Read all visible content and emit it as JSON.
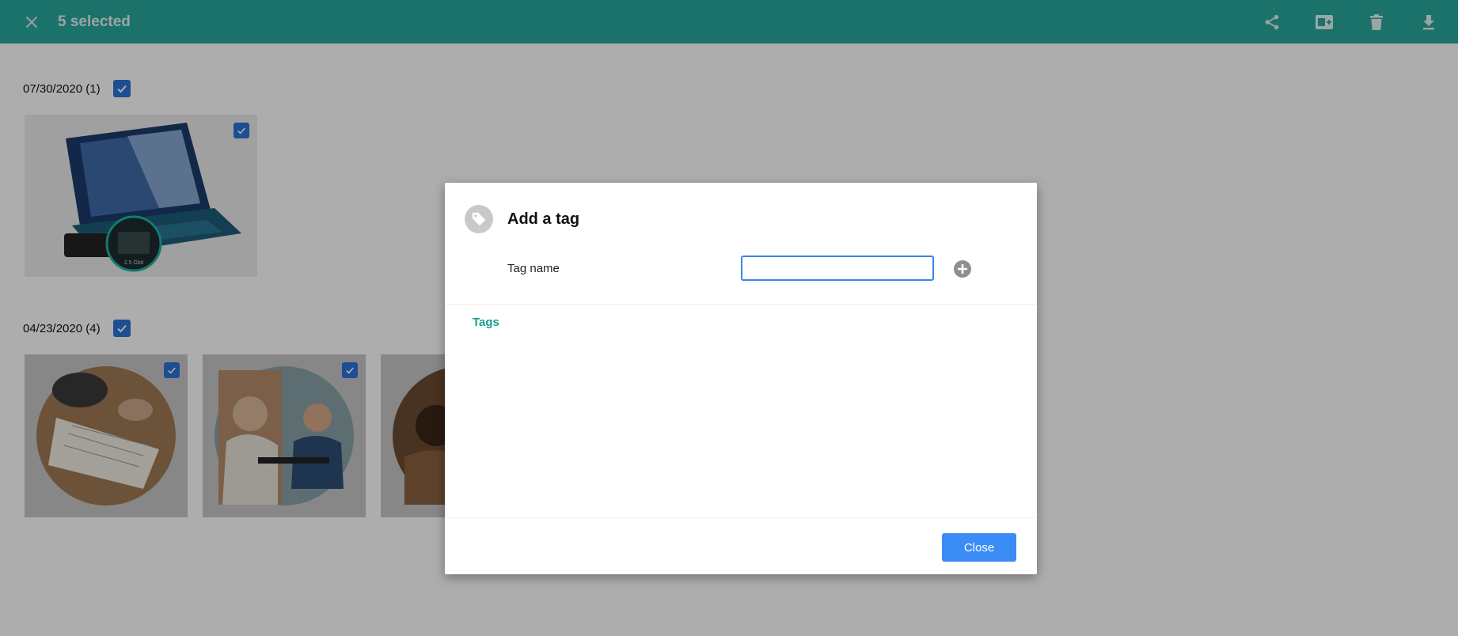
{
  "toolbar": {
    "selection_text": "5 selected",
    "close_icon": "close-icon",
    "actions": [
      {
        "name": "share-icon"
      },
      {
        "name": "add-to-album-icon"
      },
      {
        "name": "delete-icon"
      },
      {
        "name": "download-icon"
      }
    ]
  },
  "gallery": {
    "groups": [
      {
        "label": "07/30/2020 (1)",
        "checked": true
      },
      {
        "label": "04/23/2020 (4)",
        "checked": true
      }
    ]
  },
  "dialog": {
    "title": "Add a tag",
    "icon": "tag-icon",
    "field_label": "Tag name",
    "input_value": "",
    "add_icon": "plus-circle-icon",
    "tags_heading": "Tags",
    "close_label": "Close"
  },
  "colors": {
    "toolbar": "#29a89e",
    "checkbox": "#2c74d9",
    "accent_teal": "#1a9c96",
    "primary_button": "#3b8cf4"
  }
}
